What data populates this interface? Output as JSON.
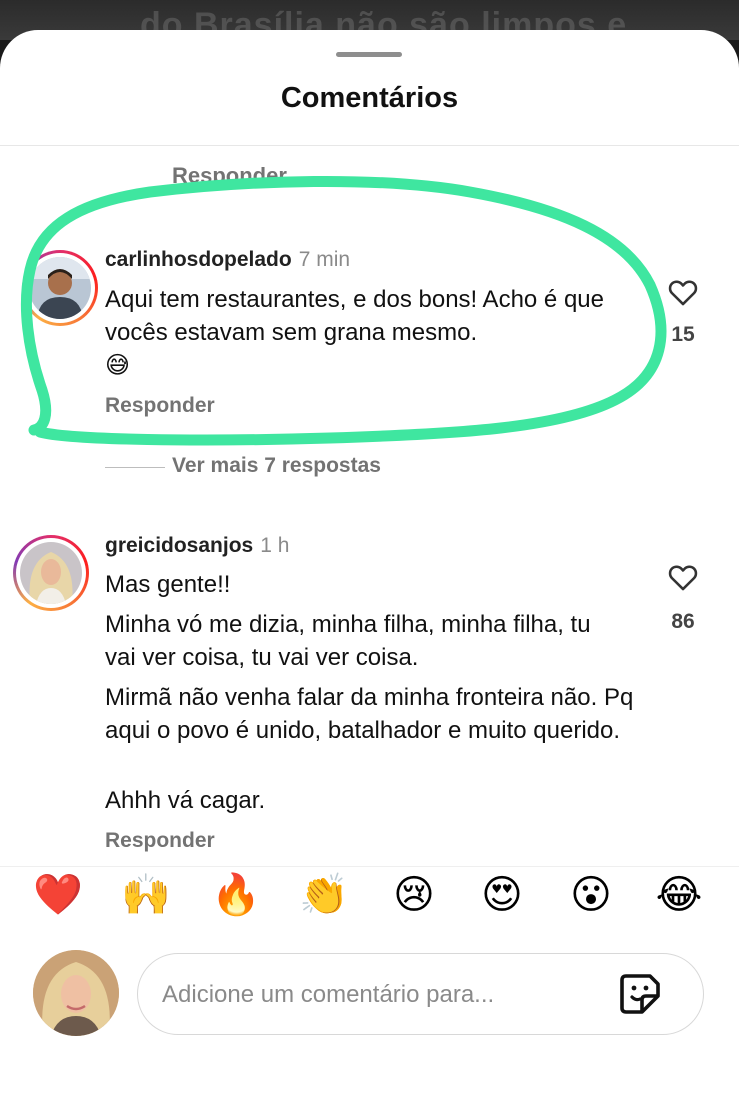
{
  "background": {
    "text": "do Brasília não são limpos e"
  },
  "header": {
    "title": "Comentários"
  },
  "top_reply": {
    "label": "Responder"
  },
  "comments": [
    {
      "username": "carlinhosdopelado",
      "time": "7 min",
      "text": "Aqui tem restaurantes, e dos bons! Acho é que vocês estavam sem grana mesmo.",
      "emoji": "😅",
      "reply_label": "Responder",
      "likes": "15",
      "view_more": "Ver mais 7 respostas"
    },
    {
      "username": "greicidosanjos",
      "time": "1 h",
      "paragraphs": [
        "Mas gente!!",
        "Minha vó me dizia, minha filha, minha filha, tu vai ver coisa, tu vai ver coisa.",
        "Mirmã não venha falar da minha fronteira não. Pq aqui o povo é unido, batalhador e muito querido.",
        "Ahhh vá cagar."
      ],
      "reply_label": "Responder",
      "likes": "86"
    }
  ],
  "reactions": [
    "❤️",
    "🙌",
    "🔥",
    "👏",
    "😢",
    "😍",
    "😮",
    "😂"
  ],
  "composer": {
    "placeholder": "Adicione um comentário para..."
  },
  "colors": {
    "highlight": "#3fe6a0",
    "story_ring": "#e1306c"
  },
  "icons": {
    "like": "heart-icon",
    "sticker": "sticker-icon"
  }
}
